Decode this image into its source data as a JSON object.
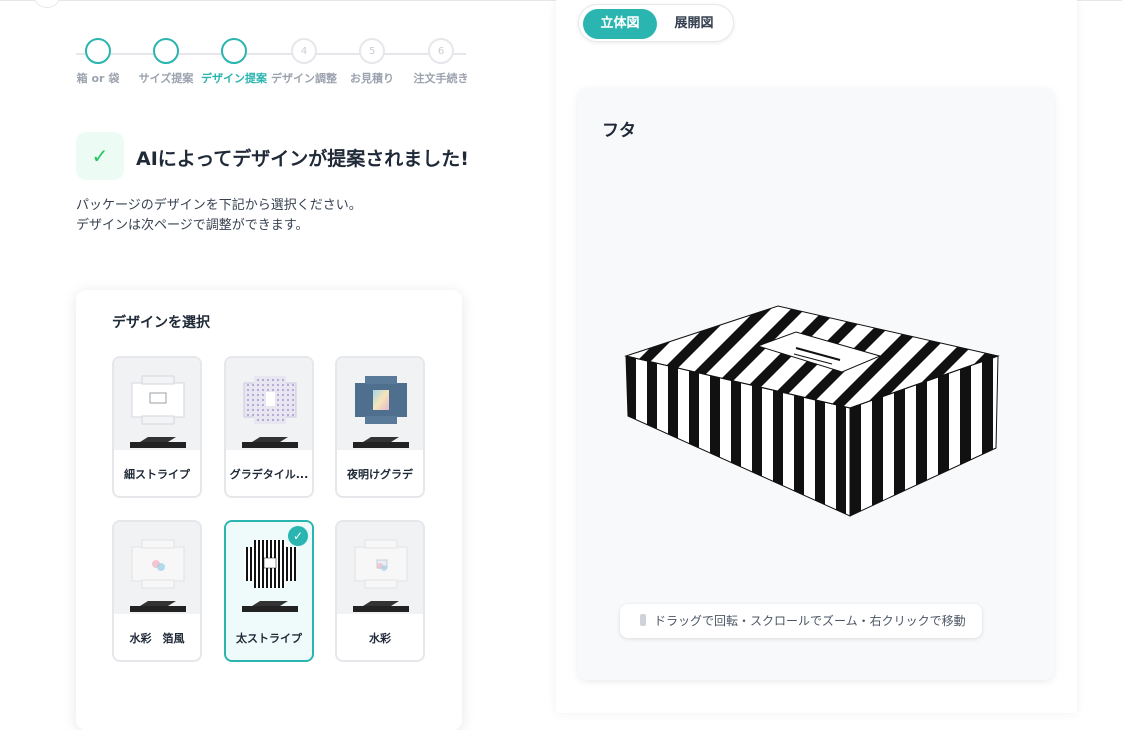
{
  "stepper": {
    "steps": [
      {
        "number": "",
        "label": "箱 or 袋"
      },
      {
        "number": "",
        "label": "サイズ提案"
      },
      {
        "number": "",
        "label": "デザイン提案"
      },
      {
        "number": "4",
        "label": "デザイン調整"
      },
      {
        "number": "5",
        "label": "お見積り"
      },
      {
        "number": "6",
        "label": "注文手続き"
      }
    ],
    "current_step": 3
  },
  "heading": {
    "check_icon": "check-icon",
    "title": "AIによってデザインが提案されました!"
  },
  "description": {
    "line1": "パッケージのデザインを下記から選択ください。",
    "line2": "デザインは次ページで調整ができます。"
  },
  "design_panel": {
    "title": "デザインを選択",
    "designs": [
      {
        "name": "細ストライプ",
        "selected": false
      },
      {
        "name": "グラデタイル...",
        "selected": false
      },
      {
        "name": "夜明けグラデ",
        "selected": false
      },
      {
        "name": "水彩　箔風",
        "selected": false
      },
      {
        "name": "太ストライプ",
        "selected": true
      },
      {
        "name": "水彩",
        "selected": false
      }
    ]
  },
  "view_toggle": {
    "active": "立体図",
    "inactive": "展開図"
  },
  "viewer": {
    "title": "フタ",
    "hint": "ドラッグで回転・スクロールでズーム・右クリックで移動"
  },
  "colors": {
    "accent": "#2bb5b0",
    "success": "#22c55e"
  }
}
